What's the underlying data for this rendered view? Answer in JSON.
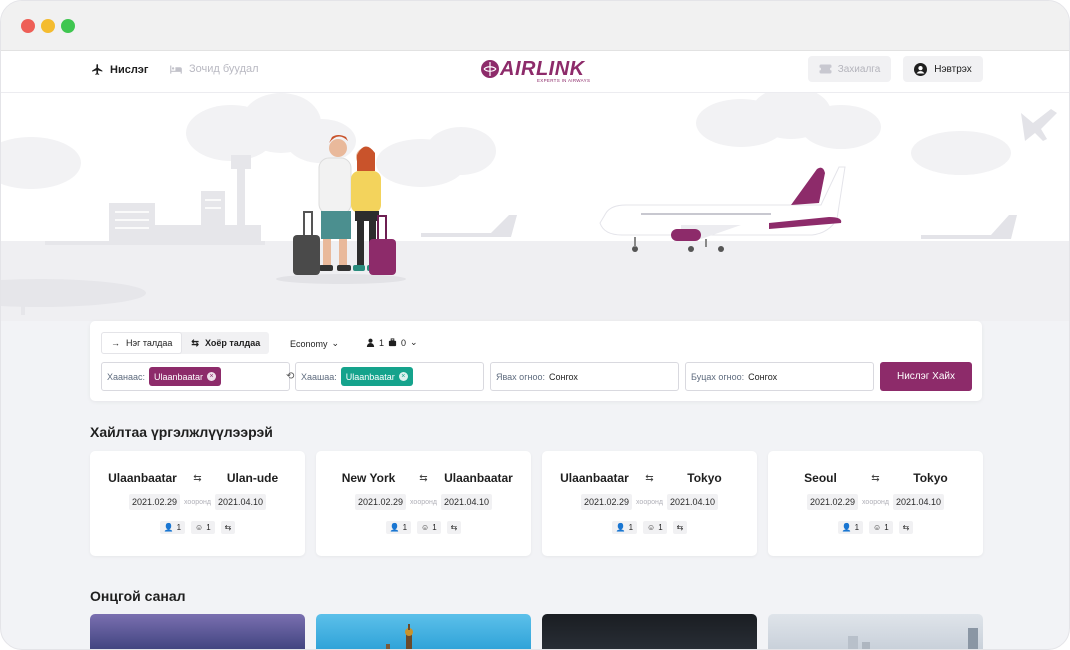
{
  "header": {
    "nav": [
      {
        "label": "Нислэг",
        "icon": "airplane-icon",
        "active": true
      },
      {
        "label": "Зочид буудал",
        "icon": "bed-icon",
        "active": false
      }
    ],
    "logo": {
      "name": "AIRLINK",
      "tagline": "EXPERTS IN AIRWAYS"
    },
    "orders_label": "Захиалга",
    "login_label": "Нэвтрэх"
  },
  "search": {
    "trip_types": [
      "Нэг талдаа",
      "Хоёр талдаа"
    ],
    "active_trip_type": "Хоёр талдаа",
    "cabin": "Economy",
    "adults": "1",
    "infants": "0",
    "from_label": "Хаанаас:",
    "from_value": "Ulaanbaatar",
    "to_label": "Хаашаа:",
    "to_value": "Ulaanbaatar",
    "depart_label": "Явах огноо:",
    "depart_value": "Сонгох",
    "return_label": "Буцах огноо:",
    "return_value": "Сонгох",
    "submit_label": "Нислэг Хайх"
  },
  "recent": {
    "title": "Хайлтаа үргэлжлүүлээрэй",
    "between_label": "хооронд",
    "cards": [
      {
        "from": "Ulaanbaatar",
        "to": "Ulan-ude",
        "depart": "2021.02.29",
        "return": "2021.04.10",
        "adults": "1",
        "children": "1"
      },
      {
        "from": "New York",
        "to": "Ulaanbaatar",
        "depart": "2021.02.29",
        "return": "2021.04.10",
        "adults": "1",
        "children": "1"
      },
      {
        "from": "Ulaanbaatar",
        "to": "Tokyo",
        "depart": "2021.02.29",
        "return": "2021.04.10",
        "adults": "1",
        "children": "1"
      },
      {
        "from": "Seoul",
        "to": "Tokyo",
        "depart": "2021.02.29",
        "return": "2021.04.10",
        "adults": "1",
        "children": "1"
      }
    ]
  },
  "offers": {
    "title": "Онцгой санал"
  },
  "colors": {
    "brand": "#8d2b6a",
    "accent_teal": "#15a38c",
    "background": "#f2f3f6"
  }
}
